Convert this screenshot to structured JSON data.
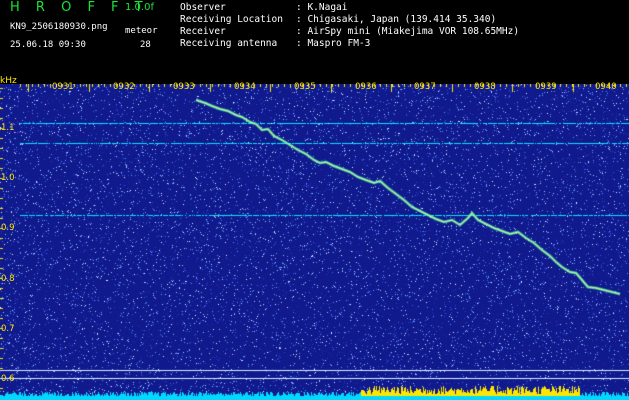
{
  "header": {
    "app_name": "H R O F F T",
    "version": "1.0.0f",
    "filename": "KN9_2506180930.png",
    "datetime": "25.06.18 09:30",
    "meteor_label": "meteor",
    "meteor_count": "28",
    "info": [
      {
        "key": "Observer",
        "value": ": K.Nagai"
      },
      {
        "key": "Receiving Location",
        "value": ": Chigasaki, Japan (139.414 35.340)"
      },
      {
        "key": "Receiver",
        "value": ": AirSpy mini (Miakejima VOR 108.65MHz)"
      },
      {
        "key": "Receiving antenna",
        "value": ": Maspro FM-3"
      }
    ]
  },
  "spectrogram": {
    "y_unit": "kHz",
    "y_ticks": [
      "1.1",
      "1.0",
      "0.9",
      "0.8",
      "0.7",
      "0.6"
    ],
    "x_ticks": [
      "0931",
      "0932",
      "0933",
      "0934",
      "0935",
      "0936",
      "0937",
      "0938",
      "0939",
      "0940"
    ],
    "colors": {
      "background": "#101a8c",
      "tick": "#ffe600",
      "signal": "#b9ffb0",
      "noise_band": "#00e5ff"
    }
  }
}
